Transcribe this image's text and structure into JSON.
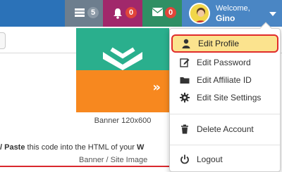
{
  "topbar": {
    "stats_count": "5",
    "notifications_count": "0",
    "messages_count": "0",
    "welcome": "Welcome,",
    "username": "Gino"
  },
  "content": {
    "banner_caption": "Banner 120x600",
    "instruction_bold": "/ Paste",
    "instruction_text": " this code into the HTML of your ",
    "instruction_tail": "W",
    "subcaption": "Banner / Site Image"
  },
  "menu": {
    "edit_profile": "Edit Profile",
    "edit_password": "Edit Password",
    "edit_affiliate": "Edit Affiliate ID",
    "edit_settings": "Edit Site Settings",
    "delete_account": "Delete Account",
    "logout": "Logout"
  },
  "colors": {
    "navbar": "#2b72b8",
    "stats_tile": "#6d7e8e",
    "bell_tile": "#a1286b",
    "mail_tile": "#2f8f64",
    "highlight": "#fbe38e",
    "highlight_border": "#e02b2b"
  },
  "icons": [
    "server-icon",
    "bell-icon",
    "envelope-icon",
    "avatar",
    "caret-down-icon",
    "user-icon",
    "edit-icon",
    "folder-icon",
    "gear-icon",
    "trash-icon",
    "power-icon"
  ]
}
